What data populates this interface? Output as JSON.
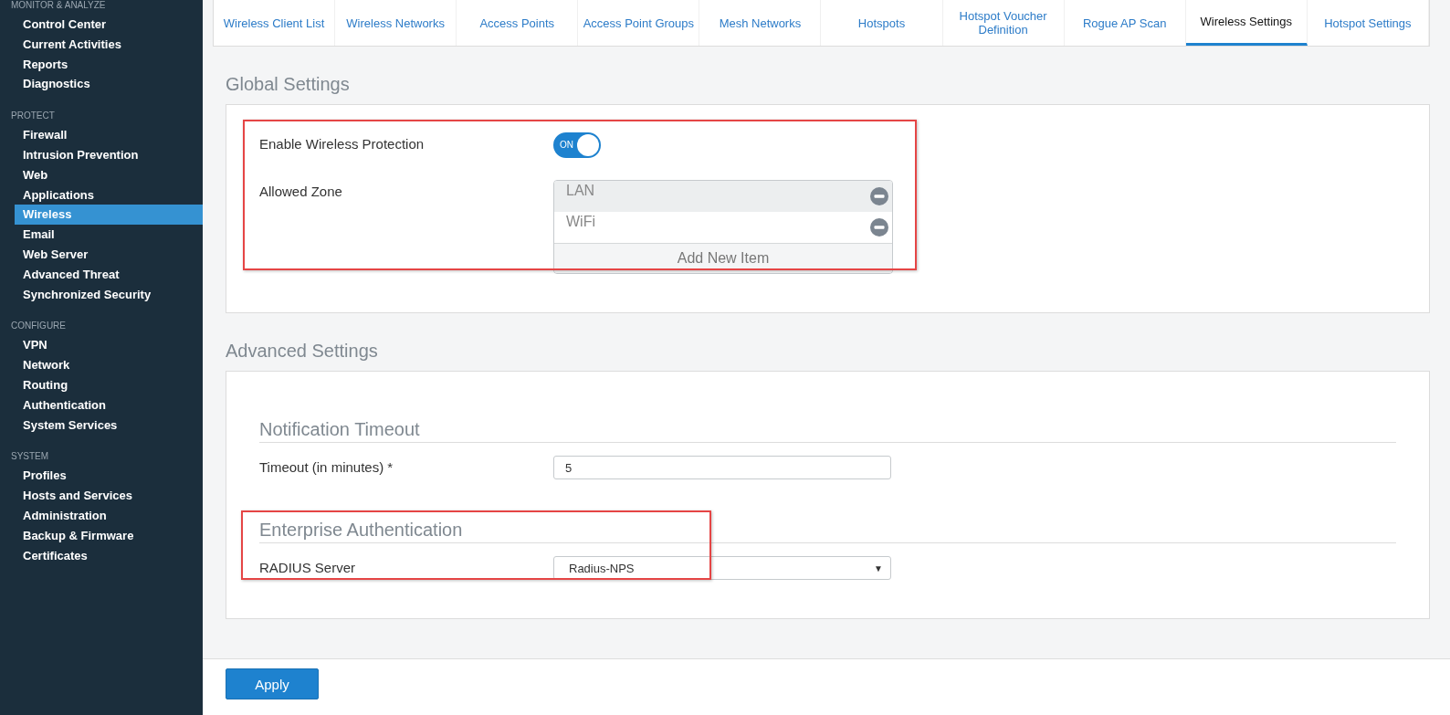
{
  "sidebar": {
    "sections": [
      {
        "title": "MONITOR & ANALYZE",
        "items": [
          {
            "label": "Control Center",
            "selected": false
          },
          {
            "label": "Current Activities",
            "selected": false
          },
          {
            "label": "Reports",
            "selected": false
          },
          {
            "label": "Diagnostics",
            "selected": false
          }
        ]
      },
      {
        "title": "PROTECT",
        "items": [
          {
            "label": "Firewall",
            "selected": false
          },
          {
            "label": "Intrusion Prevention",
            "selected": false
          },
          {
            "label": "Web",
            "selected": false
          },
          {
            "label": "Applications",
            "selected": false
          },
          {
            "label": "Wireless",
            "selected": true
          },
          {
            "label": "Email",
            "selected": false
          },
          {
            "label": "Web Server",
            "selected": false
          },
          {
            "label": "Advanced Threat",
            "selected": false
          },
          {
            "label": "Synchronized Security",
            "selected": false
          }
        ]
      },
      {
        "title": "CONFIGURE",
        "items": [
          {
            "label": "VPN",
            "selected": false
          },
          {
            "label": "Network",
            "selected": false
          },
          {
            "label": "Routing",
            "selected": false
          },
          {
            "label": "Authentication",
            "selected": false
          },
          {
            "label": "System Services",
            "selected": false
          }
        ]
      },
      {
        "title": "SYSTEM",
        "items": [
          {
            "label": "Profiles",
            "selected": false
          },
          {
            "label": "Hosts and Services",
            "selected": false
          },
          {
            "label": "Administration",
            "selected": false
          },
          {
            "label": "Backup & Firmware",
            "selected": false
          },
          {
            "label": "Certificates",
            "selected": false
          }
        ]
      }
    ]
  },
  "tabs": [
    {
      "label": "Wireless Client List",
      "selected": false
    },
    {
      "label": "Wireless Networks",
      "selected": false
    },
    {
      "label": "Access Points",
      "selected": false
    },
    {
      "label": "Access Point Groups",
      "selected": false
    },
    {
      "label": "Mesh Networks",
      "selected": false
    },
    {
      "label": "Hotspots",
      "selected": false
    },
    {
      "label": "Hotspot Voucher Definition",
      "selected": false
    },
    {
      "label": "Rogue AP Scan",
      "selected": false
    },
    {
      "label": "Wireless Settings",
      "selected": true
    },
    {
      "label": "Hotspot Settings",
      "selected": false
    }
  ],
  "sections": [
    {
      "title": "Global Settings",
      "groups": [
        {
          "highlighted": true,
          "fields": [
            {
              "kind": "toggle",
              "label": "Enable Wireless Protection",
              "on": true,
              "text": "ON"
            },
            {
              "kind": "list",
              "label": "Allowed Zone",
              "items": [
                {
                  "text": "LAN",
                  "hovered": true
                },
                {
                  "text": "WiFi",
                  "hovered": false
                }
              ],
              "add_label": "Add New Item"
            }
          ]
        }
      ]
    },
    {
      "title": "Advanced Settings",
      "groups": [
        {
          "heading": "Notification Timeout",
          "highlighted": false,
          "fields": [
            {
              "kind": "text",
              "label": "Timeout (in minutes) *",
              "value": "5"
            }
          ]
        },
        {
          "heading": "Enterprise Authentication",
          "highlighted": true,
          "fields": [
            {
              "kind": "select",
              "label": "RADIUS Server",
              "value": "Radius-NPS",
              "caret": "▼"
            }
          ]
        }
      ]
    }
  ],
  "apply_button": "Apply"
}
